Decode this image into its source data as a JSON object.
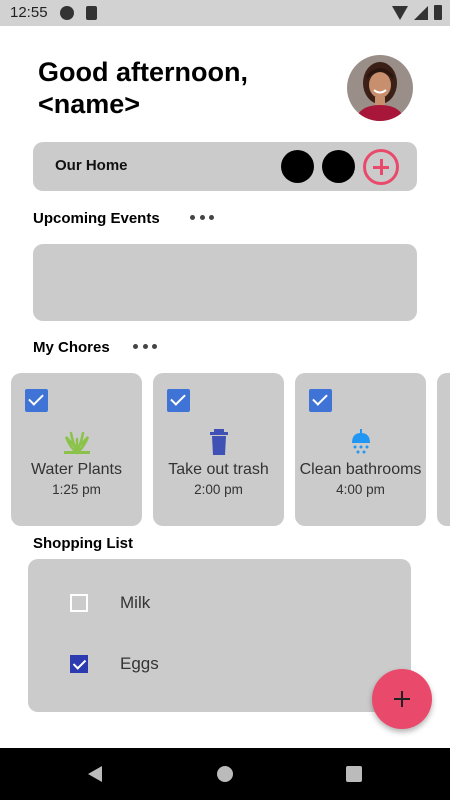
{
  "status_bar": {
    "time": "12:55"
  },
  "header": {
    "greeting": "Good afternoon, <name>"
  },
  "home": {
    "title": "Our Home"
  },
  "sections": {
    "events_title": "Upcoming Events",
    "chores_title": "My Chores",
    "shopping_title": "Shopping List"
  },
  "chores": [
    {
      "name": "Water Plants",
      "time": "1:25 pm",
      "icon": "plant-icon",
      "color": "#8bc34a",
      "checked": true
    },
    {
      "name": "Take out trash",
      "time": "2:00 pm",
      "icon": "trash-icon",
      "color": "#3f51b5",
      "checked": true
    },
    {
      "name": "Clean bathrooms",
      "time": "4:00 pm",
      "icon": "shower-icon",
      "color": "#2196f3",
      "checked": true
    }
  ],
  "shopping": [
    {
      "label": "Milk",
      "checked": false
    },
    {
      "label": "Eggs",
      "checked": true
    }
  ],
  "colors": {
    "accent": "#e94a6b",
    "card": "#cbcbcb",
    "checkbox": "#3f74d6"
  }
}
